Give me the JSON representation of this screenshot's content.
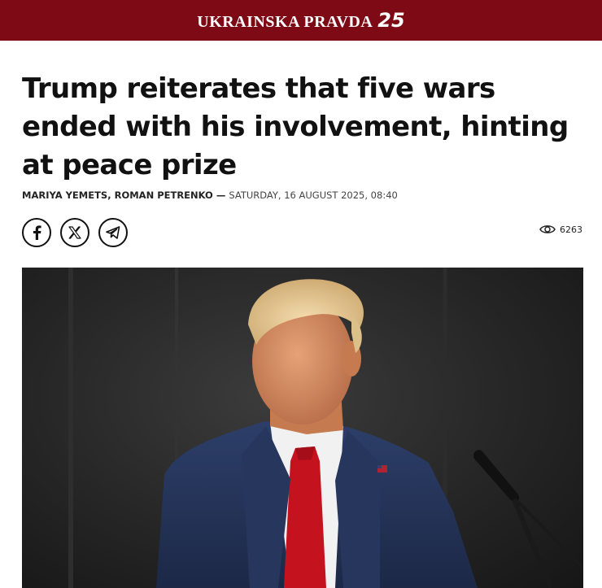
{
  "header": {
    "brand_name": "UKRAINSKA PRAVDA",
    "brand_number": "25",
    "background_color": "#7d0a14"
  },
  "article": {
    "headline": "Trump reiterates that five wars ended with his involvement, hinting at peace prize",
    "authors": "MARIYA YEMETS, ROMAN PETRENKO —",
    "date": "SATURDAY, 16 AUGUST 2025, 08:40",
    "views": "6263"
  },
  "share": {
    "facebook_icon": "facebook-icon",
    "x_icon": "x-icon",
    "telegram_icon": "telegram-icon"
  },
  "hero_image": {
    "alt": "Photo of Donald Trump in a navy suit and red tie beside a microphone"
  }
}
